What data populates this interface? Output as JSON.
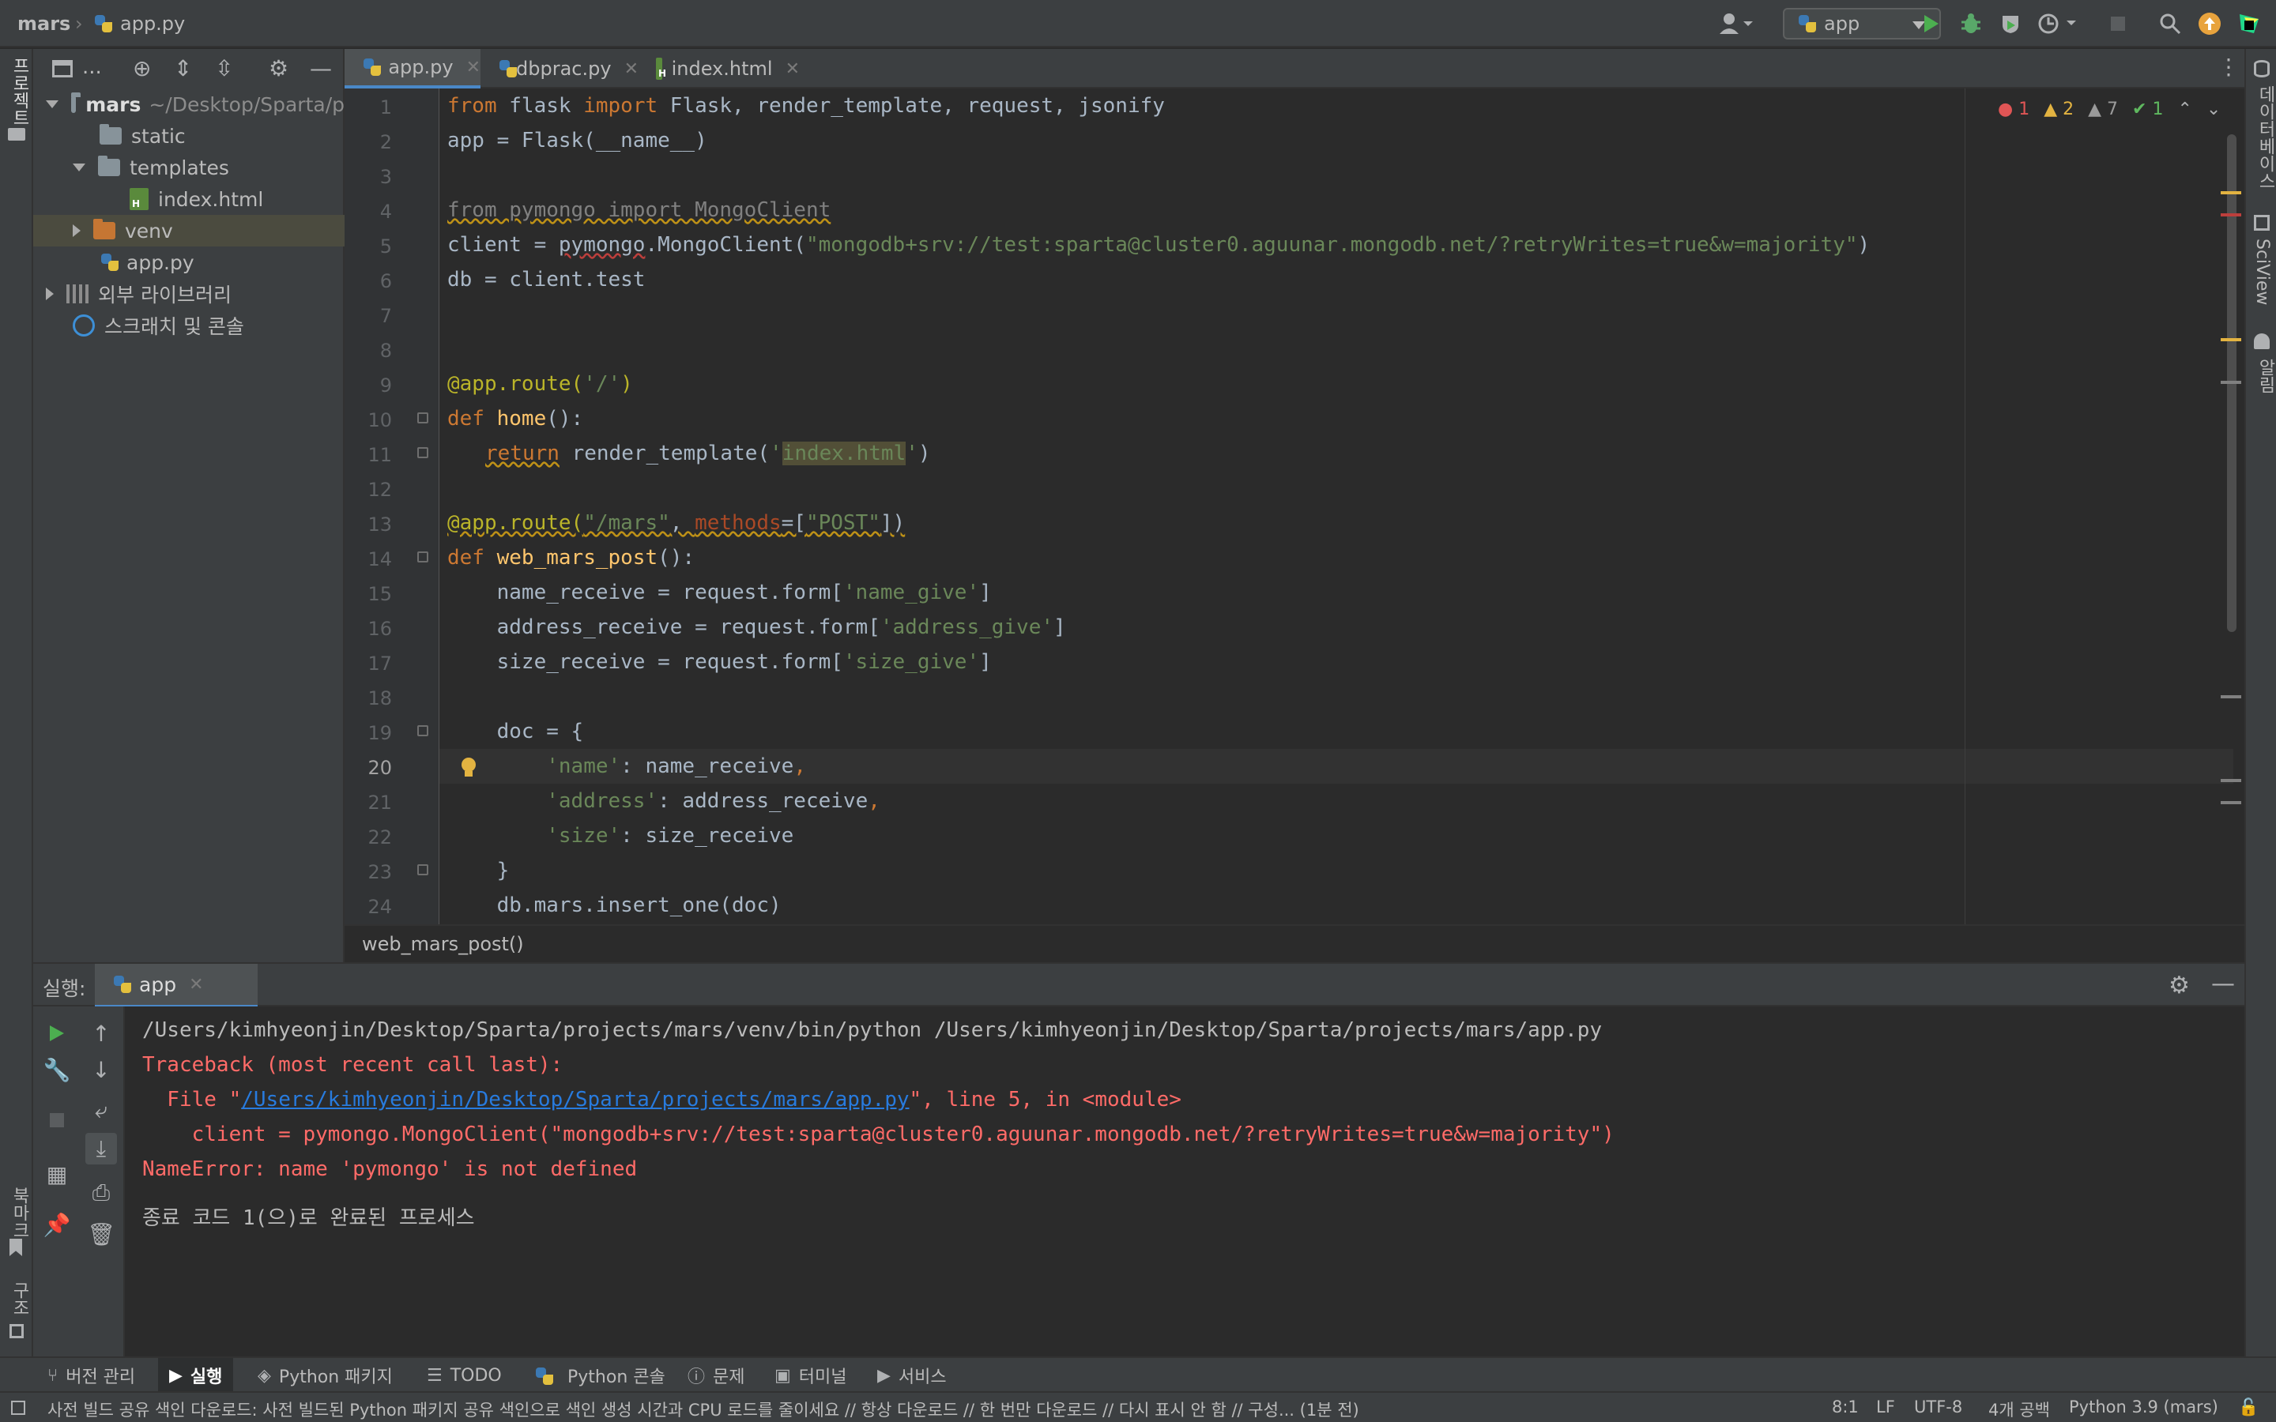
{
  "titlebar": {
    "project": "mars",
    "file": "app.py",
    "run_config": "app"
  },
  "left_strip": {
    "project_label": "프로젝트",
    "bookmarks_label": "북마크",
    "structure_label": "구조"
  },
  "right_strip": {
    "database_label": "데이터베이스",
    "sciview_label": "SciView",
    "notifications_label": "알림"
  },
  "project_panel": {
    "title": "...",
    "tree": [
      {
        "label": "mars",
        "path": "~/Desktop/Sparta/p",
        "kind": "folder",
        "expanded": true
      },
      {
        "label": "static",
        "kind": "folder"
      },
      {
        "label": "templates",
        "kind": "folder",
        "expanded": true
      },
      {
        "label": "index.html",
        "kind": "html"
      },
      {
        "label": "venv",
        "kind": "folder-excluded",
        "expanded": false,
        "selected": true
      },
      {
        "label": "app.py",
        "kind": "python"
      },
      {
        "label": "외부 라이브러리",
        "kind": "libraries",
        "expanded": false
      },
      {
        "label": "스크래치 및 콘솔",
        "kind": "scratches"
      }
    ]
  },
  "editor": {
    "tabs": [
      {
        "label": "app.py",
        "active": true
      },
      {
        "label": "dbprac.py",
        "active": false
      },
      {
        "label": "index.html",
        "active": false
      }
    ],
    "line_numbers": [
      "1",
      "2",
      "3",
      "4",
      "5",
      "6",
      "7",
      "8",
      "9",
      "10",
      "11",
      "12",
      "13",
      "14",
      "15",
      "16",
      "17",
      "18",
      "19",
      "20",
      "21",
      "22",
      "23",
      "24"
    ],
    "current_line": "20",
    "code": {
      "l1": {
        "kw_from": "from",
        "mod": " flask ",
        "kw_import": "import",
        "rest": " Flask, render_template, request, jsonify"
      },
      "l2": "app = Flask(__name__)",
      "l4": "from pymongo import MongoClient",
      "l5_a": "client = ",
      "l5_b": "pymongo",
      "l5_c": ".MongoClient(",
      "l5_d": "\"mongodb+srv://test:sparta@cluster0.aguunar.mongodb.net/?retryWrites=true&w=majority\"",
      "l5_e": ")",
      "l6": "db = client.test",
      "l9_a": "@app.route(",
      "l9_b": "'/'",
      "l9_c": ")",
      "l10_a": "def",
      "l10_b": "home",
      "l10_c": "():",
      "l11_a": "return",
      "l11_b": " render_template(",
      "l11_c": "'",
      "l11_d": "index.html",
      "l11_e": "'",
      "l11_f": ")",
      "l13_a": "@app.route(",
      "l13_b": "\"/mars\"",
      "l13_c": ", ",
      "l13_d": "methods",
      "l13_e": "=[",
      "l13_f": "\"POST\"",
      "l13_g": "])",
      "l14_a": "def",
      "l14_b": "web_mars_post",
      "l14_c": "():",
      "l15_a": "    name_receive = request.form[",
      "l15_b": "'name_give'",
      "l15_c": "]",
      "l16_a": "    address_receive = request.form[",
      "l16_b": "'address_give'",
      "l16_c": "]",
      "l17_a": "    size_receive = request.form[",
      "l17_b": "'size_give'",
      "l17_c": "]",
      "l19": "    doc = {",
      "l20_a": "        ",
      "l20_b": "'name'",
      "l20_c": ": name_receive",
      "l20_d": ",",
      "l21_a": "        ",
      "l21_b": "'address'",
      "l21_c": ": address_receive",
      "l21_d": ",",
      "l22_a": "        ",
      "l22_b": "'size'",
      "l22_c": ": size_receive",
      "l23": "    }",
      "l24": "    db.mars.insert_one(doc)"
    },
    "inspection": {
      "errors": "1",
      "warnings": "2",
      "weak_warnings": "7",
      "typos": "1"
    },
    "breadcrumb": "web_mars_post()"
  },
  "run_panel": {
    "label": "실행:",
    "tab": "app",
    "console": {
      "cmd": "/Users/kimhyeonjin/Desktop/Sparta/projects/mars/venv/bin/python /Users/kimhyeonjin/Desktop/Sparta/projects/mars/app.py",
      "tb": "Traceback (most recent call last):",
      "file_pre": "  File \"",
      "file_link": "/Users/kimhyeonjin/Desktop/Sparta/projects/mars/app.py",
      "file_post": "\", line 5, in <module>",
      "code": "    client = pymongo.MongoClient(\"mongodb+srv://test:sparta@cluster0.aguunar.mongodb.net/?retryWrites=true&w=majority\")",
      "err": "NameError: name 'pymongo' is not defined",
      "exit": "종료 코드 1(으)로 완료된 프로세스"
    }
  },
  "tool_windows": [
    {
      "label": "버전 관리",
      "icon": "branch-icon"
    },
    {
      "label": "실행",
      "icon": "run-icon",
      "active": true
    },
    {
      "label": "Python 패키지",
      "icon": "layers-icon"
    },
    {
      "label": "TODO",
      "icon": "list-icon"
    },
    {
      "label": "Python 콘솔",
      "icon": "python-icon"
    },
    {
      "label": "문제",
      "icon": "problems-icon"
    },
    {
      "label": "터미널",
      "icon": "terminal-icon"
    },
    {
      "label": "서비스",
      "icon": "services-icon"
    }
  ],
  "status_bar": {
    "message": "사전 빌드 공유 색인 다운로드: 사전 빌드된 Python 패키지 공유 색인으로 색인 생성 시간과 CPU 로드를 줄이세요 // 항상 다운로드 // 한 번만 다운로드 // 다시 표시 안 함 // 구성... (1분 전)",
    "position": "8:1",
    "line_sep": "LF",
    "encoding": "UTF-8",
    "indent": "4개 공백",
    "interpreter": "Python 3.9 (mars)"
  },
  "colors": {
    "accent": "#4a88c7",
    "error": "#ff6b68",
    "run_green": "#4caf50",
    "debug_green": "#59a869",
    "update_orange": "#e8a33d"
  }
}
